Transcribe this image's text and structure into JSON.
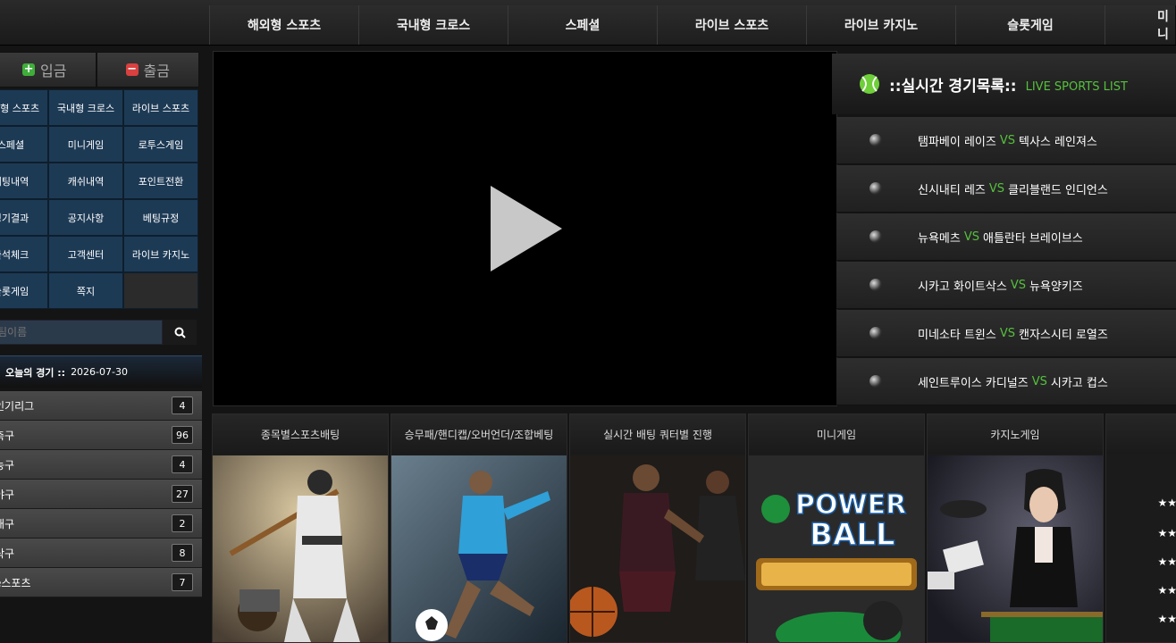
{
  "nav": [
    "해외형 스포츠",
    "국내형 크로스",
    "스페셜",
    "라이브 스포츠",
    "라이브 카지노",
    "슬롯게임",
    "미니"
  ],
  "sidebar": {
    "deposit": "입금",
    "withdraw": "출금",
    "menu": [
      "해외형 스포츠",
      "국내형 크로스",
      "라이브 스포츠",
      "스페셜",
      "미니게임",
      "로투스게임",
      "배팅내역",
      "캐쉬내역",
      "포인트전환",
      "경기결과",
      "공지사항",
      "베팅규정",
      "출석체크",
      "고객센터",
      "라이브 카지노",
      "슬롯게임",
      "쪽지",
      ""
    ],
    "search_placeholder": "팀이름",
    "today_label": "오늘의 경기 ::",
    "today_date": "2026-07-30",
    "leagues": [
      {
        "name": "인기리그",
        "count": "4"
      },
      {
        "name": "축구",
        "count": "96"
      },
      {
        "name": "농구",
        "count": "4"
      },
      {
        "name": "야구",
        "count": "27"
      },
      {
        "name": "배구",
        "count": "2"
      },
      {
        "name": "탁구",
        "count": "8"
      },
      {
        "name": "e스포츠",
        "count": "7"
      }
    ]
  },
  "live": {
    "title": "::실시간 경기목록::",
    "subtitle": "LIVE SPORTS LIST",
    "matches": [
      {
        "home": "탬파베이 레이즈",
        "vs": "VS",
        "away": "텍사스 레인져스"
      },
      {
        "home": "신시내티 레즈",
        "vs": "VS",
        "away": "클리블랜드 인디언스"
      },
      {
        "home": "뉴욕메츠",
        "vs": "VS",
        "away": "애틀란타 브레이브스"
      },
      {
        "home": "시카고 화이트삭스",
        "vs": "VS",
        "away": "뉴욕양키즈"
      },
      {
        "home": "미네소타 트윈스",
        "vs": "VS",
        "away": "캔자스시티 로열즈"
      },
      {
        "home": "세인트루이스 카디널즈",
        "vs": "VS",
        "away": "시카고 컵스"
      }
    ]
  },
  "cards": [
    "종목별스포츠배팅",
    "승무패/핸디캡/오버언더/조합베팅",
    "실시간 배팅 쿼터별 진행",
    "미니게임",
    "카지노게임",
    ""
  ],
  "stars": [
    "★★",
    "★★",
    "★★",
    "★★",
    "★★"
  ],
  "colors": {
    "accent_green": "#56c13d",
    "menu_blue": "#1d3a55"
  }
}
